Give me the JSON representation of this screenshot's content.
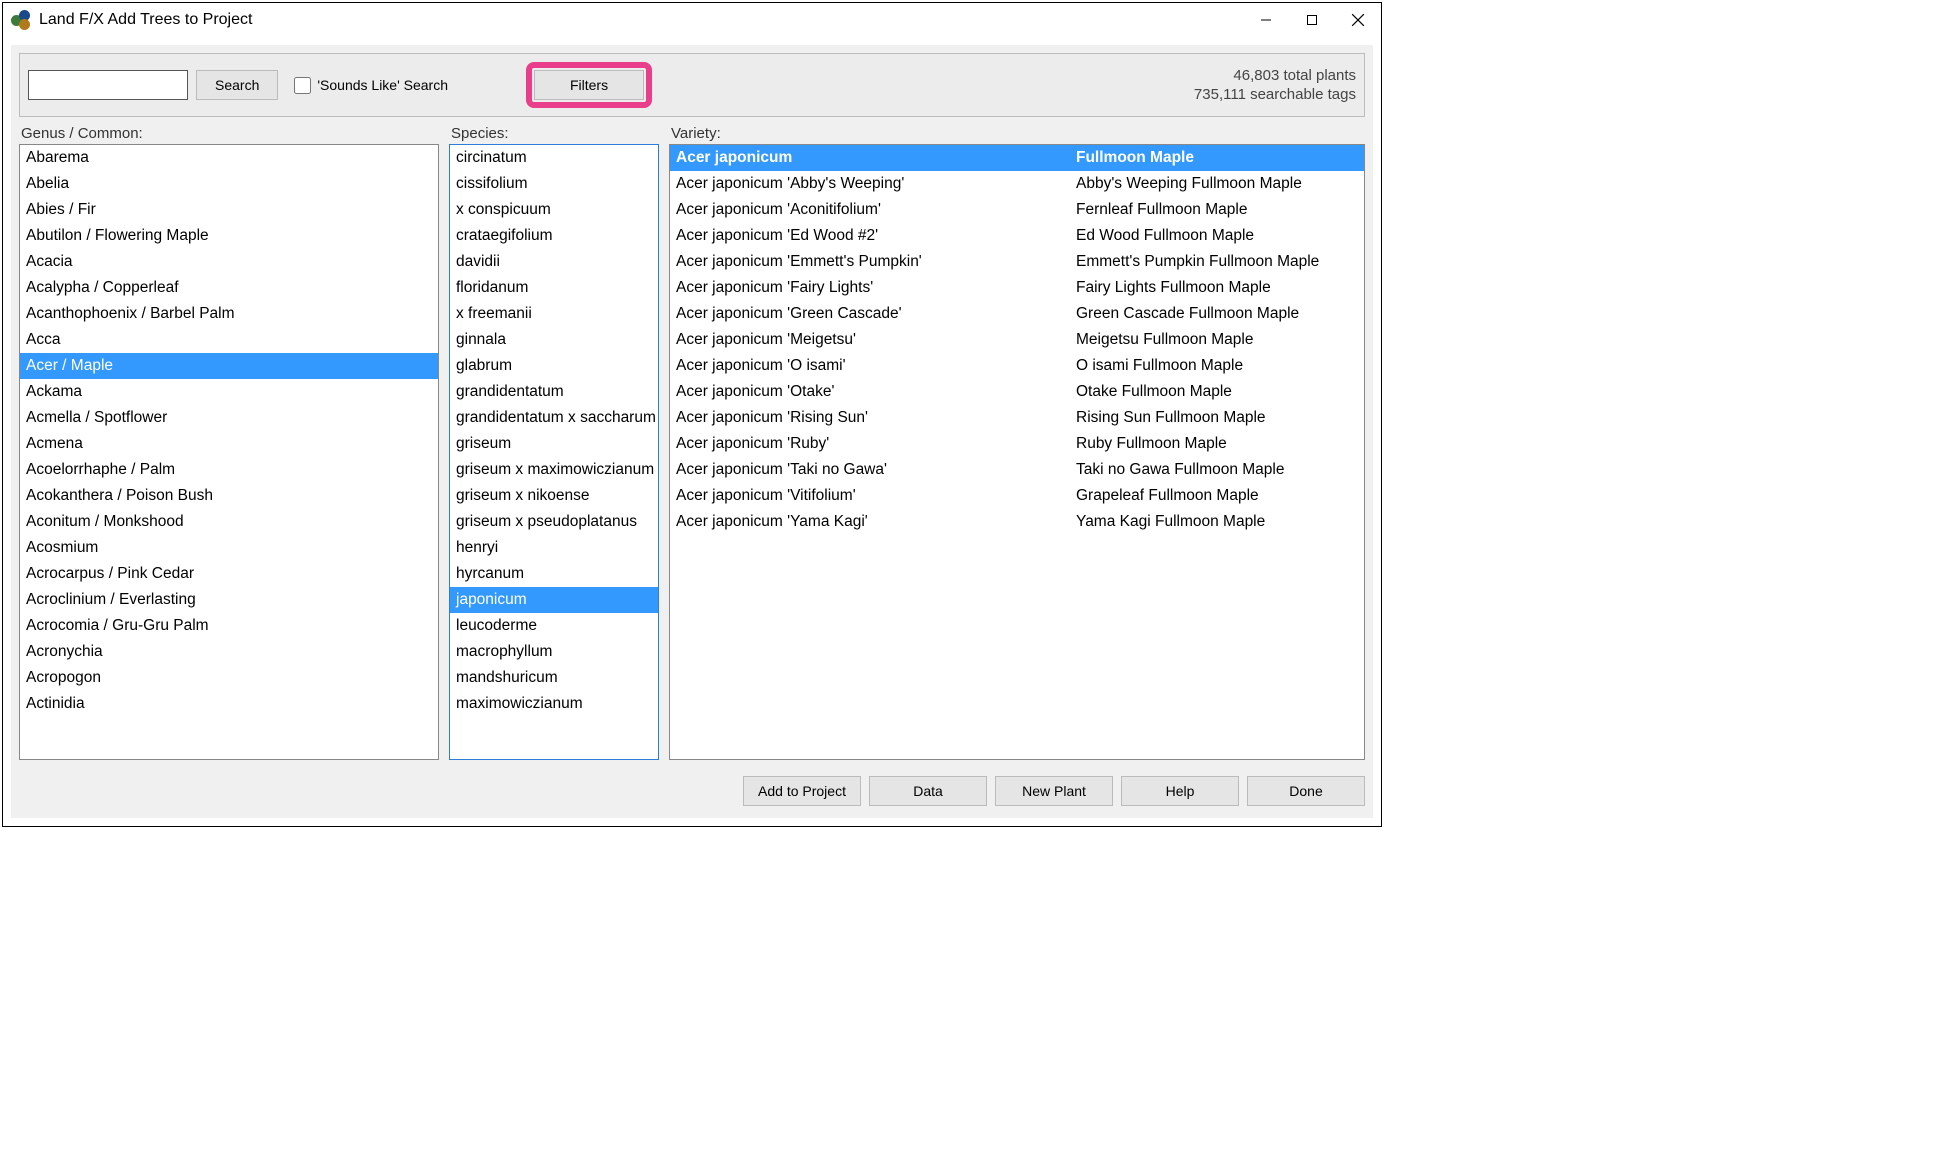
{
  "window": {
    "title": "Land F/X Add Trees to Project"
  },
  "toolbar": {
    "search_value": "",
    "search_button": "Search",
    "sounds_like_label": "'Sounds Like' Search",
    "filters_button": "Filters"
  },
  "stats": {
    "line1": "46,803 total plants",
    "line2": "735,111 searchable tags"
  },
  "labels": {
    "genus": "Genus / Common:",
    "species": "Species:",
    "variety": "Variety:"
  },
  "genus": {
    "selected_index": 8,
    "items": [
      "Abarema",
      "Abelia",
      "Abies / Fir",
      "Abutilon / Flowering Maple",
      "Acacia",
      "Acalypha / Copperleaf",
      "Acanthophoenix / Barbel Palm",
      "Acca",
      "Acer / Maple",
      "Ackama",
      "Acmella / Spotflower",
      "Acmena",
      "Acoelorrhaphe / Palm",
      "Acokanthera / Poison Bush",
      "Aconitum / Monkshood",
      "Acosmium",
      "Acrocarpus / Pink Cedar",
      "Acroclinium / Everlasting",
      "Acrocomia / Gru-Gru Palm",
      "Acronychia",
      "Acropogon",
      "Actinidia"
    ]
  },
  "species": {
    "selected_index": 17,
    "items": [
      "circinatum",
      "cissifolium",
      "x conspicuum",
      "crataegifolium",
      "davidii",
      "floridanum",
      "x freemanii",
      "ginnala",
      "glabrum",
      "grandidentatum",
      "grandidentatum x saccharum",
      "griseum",
      "griseum x maximowiczianum",
      "griseum x nikoense",
      "griseum x pseudoplatanus",
      "henryi",
      "hyrcanum",
      "japonicum",
      "leucoderme",
      "macrophyllum",
      "mandshuricum",
      "maximowiczianum"
    ]
  },
  "variety": {
    "selected_index": 0,
    "items": [
      {
        "latin": "Acer japonicum",
        "common": "Fullmoon Maple"
      },
      {
        "latin": "Acer japonicum 'Abby's Weeping'",
        "common": "Abby's Weeping Fullmoon Maple"
      },
      {
        "latin": "Acer japonicum 'Aconitifolium'",
        "common": "Fernleaf Fullmoon Maple"
      },
      {
        "latin": "Acer japonicum 'Ed Wood #2'",
        "common": "Ed Wood Fullmoon Maple"
      },
      {
        "latin": "Acer japonicum 'Emmett's Pumpkin'",
        "common": "Emmett's Pumpkin Fullmoon Maple"
      },
      {
        "latin": "Acer japonicum 'Fairy Lights'",
        "common": "Fairy Lights Fullmoon Maple"
      },
      {
        "latin": "Acer japonicum 'Green Cascade'",
        "common": "Green Cascade Fullmoon Maple"
      },
      {
        "latin": "Acer japonicum 'Meigetsu'",
        "common": "Meigetsu Fullmoon Maple"
      },
      {
        "latin": "Acer japonicum 'O isami'",
        "common": "O isami Fullmoon Maple"
      },
      {
        "latin": "Acer japonicum 'Otake'",
        "common": "Otake Fullmoon Maple"
      },
      {
        "latin": "Acer japonicum 'Rising Sun'",
        "common": "Rising Sun Fullmoon Maple"
      },
      {
        "latin": "Acer japonicum 'Ruby'",
        "common": "Ruby Fullmoon Maple"
      },
      {
        "latin": "Acer japonicum 'Taki no Gawa'",
        "common": "Taki no Gawa Fullmoon Maple"
      },
      {
        "latin": "Acer japonicum 'Vitifolium'",
        "common": "Grapeleaf Fullmoon Maple"
      },
      {
        "latin": "Acer japonicum 'Yama Kagi'",
        "common": "Yama Kagi Fullmoon Maple"
      }
    ]
  },
  "footer": {
    "add": "Add to Project",
    "data": "Data",
    "new_plant": "New Plant",
    "help": "Help",
    "done": "Done"
  }
}
